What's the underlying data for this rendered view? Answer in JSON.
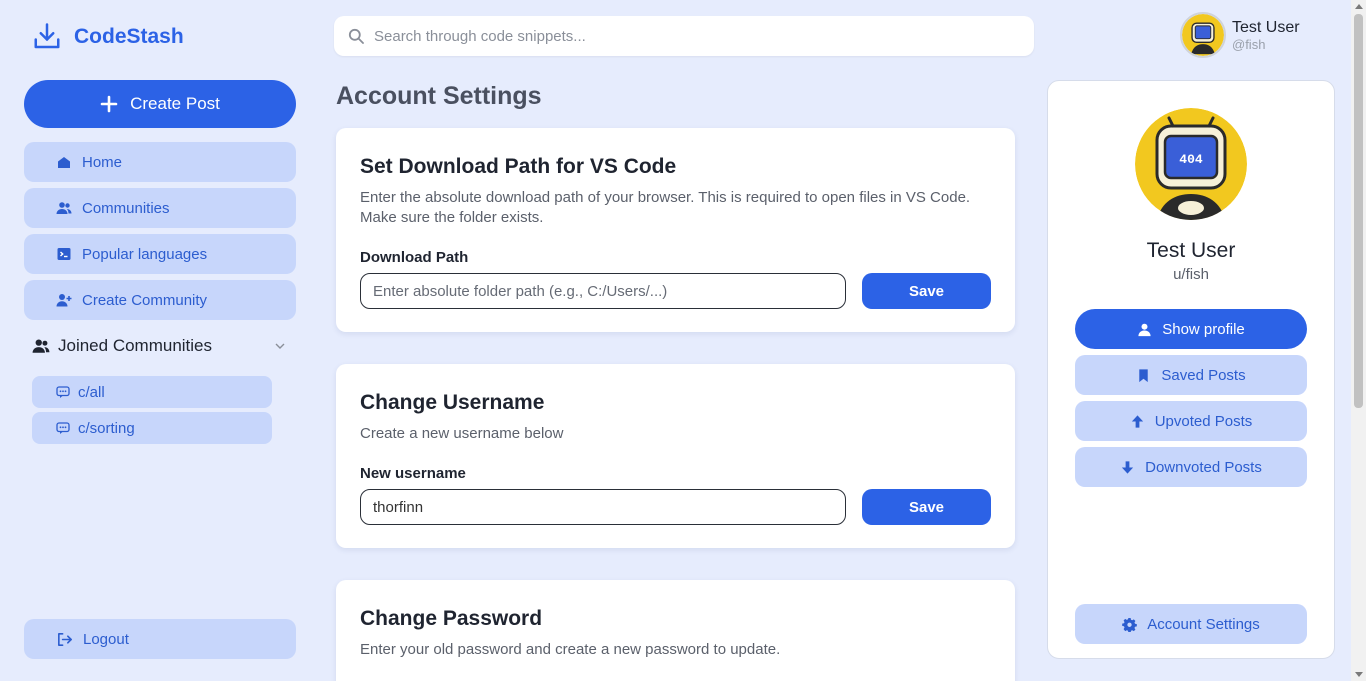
{
  "app": {
    "name": "CodeStash"
  },
  "sidebar": {
    "create_label": "Create Post",
    "items": [
      {
        "label": "Home",
        "icon": "home-icon"
      },
      {
        "label": "Communities",
        "icon": "users-icon"
      },
      {
        "label": "Popular languages",
        "icon": "terminal-icon"
      },
      {
        "label": "Create Community",
        "icon": "user-plus-icon"
      }
    ],
    "joined": {
      "title": "Joined Communities",
      "items": [
        {
          "label": "c/all"
        },
        {
          "label": "c/sorting"
        }
      ]
    },
    "logout_label": "Logout"
  },
  "search": {
    "placeholder": "Search through code snippets..."
  },
  "user": {
    "name": "Test User",
    "handle": "@fish",
    "avatar_text": "404"
  },
  "main": {
    "title": "Account Settings",
    "download": {
      "title": "Set Download Path for VS Code",
      "desc": "Enter the absolute download path of your browser. This is required to open files in VS Code. Make sure the folder exists.",
      "label": "Download Path",
      "placeholder": "Enter absolute folder path (e.g., C:/Users/...)",
      "save": "Save"
    },
    "username": {
      "title": "Change Username",
      "desc": "Create a new username below",
      "label": "New username",
      "value": "thorfinn",
      "save": "Save"
    },
    "password": {
      "title": "Change Password",
      "desc": "Enter your old password and create a new password to update."
    }
  },
  "profile": {
    "name": "Test User",
    "handle": "u/fish",
    "buttons": {
      "show": "Show profile",
      "saved": "Saved Posts",
      "upvoted": "Upvoted Posts",
      "downvoted": "Downvoted Posts",
      "settings": "Account Settings"
    }
  },
  "colors": {
    "accent": "#2c62e6",
    "background": "#e6ecfd",
    "chip": "#c7d6fb",
    "avatar_bg": "#f2c81f"
  }
}
